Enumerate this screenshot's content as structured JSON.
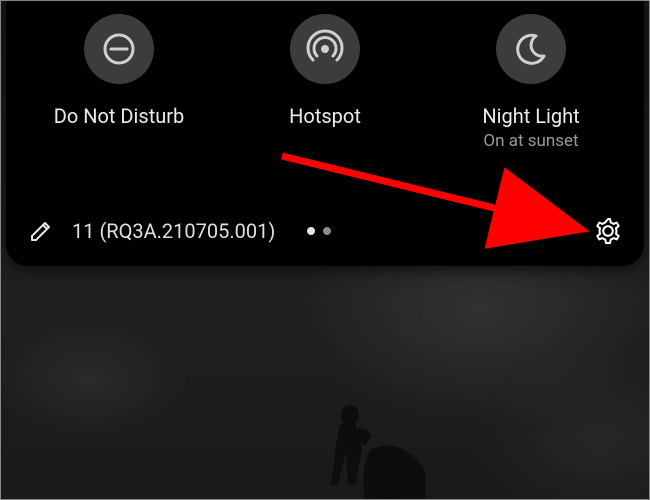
{
  "tiles": [
    {
      "icon": "dnd",
      "label": "Do Not Disturb",
      "sub": ""
    },
    {
      "icon": "hotspot",
      "label": "Hotspot",
      "sub": ""
    },
    {
      "icon": "nightlight",
      "label": "Night Light",
      "sub": "On at sunset"
    }
  ],
  "footer": {
    "build_text": "11 (RQ3A.210705.001)"
  }
}
